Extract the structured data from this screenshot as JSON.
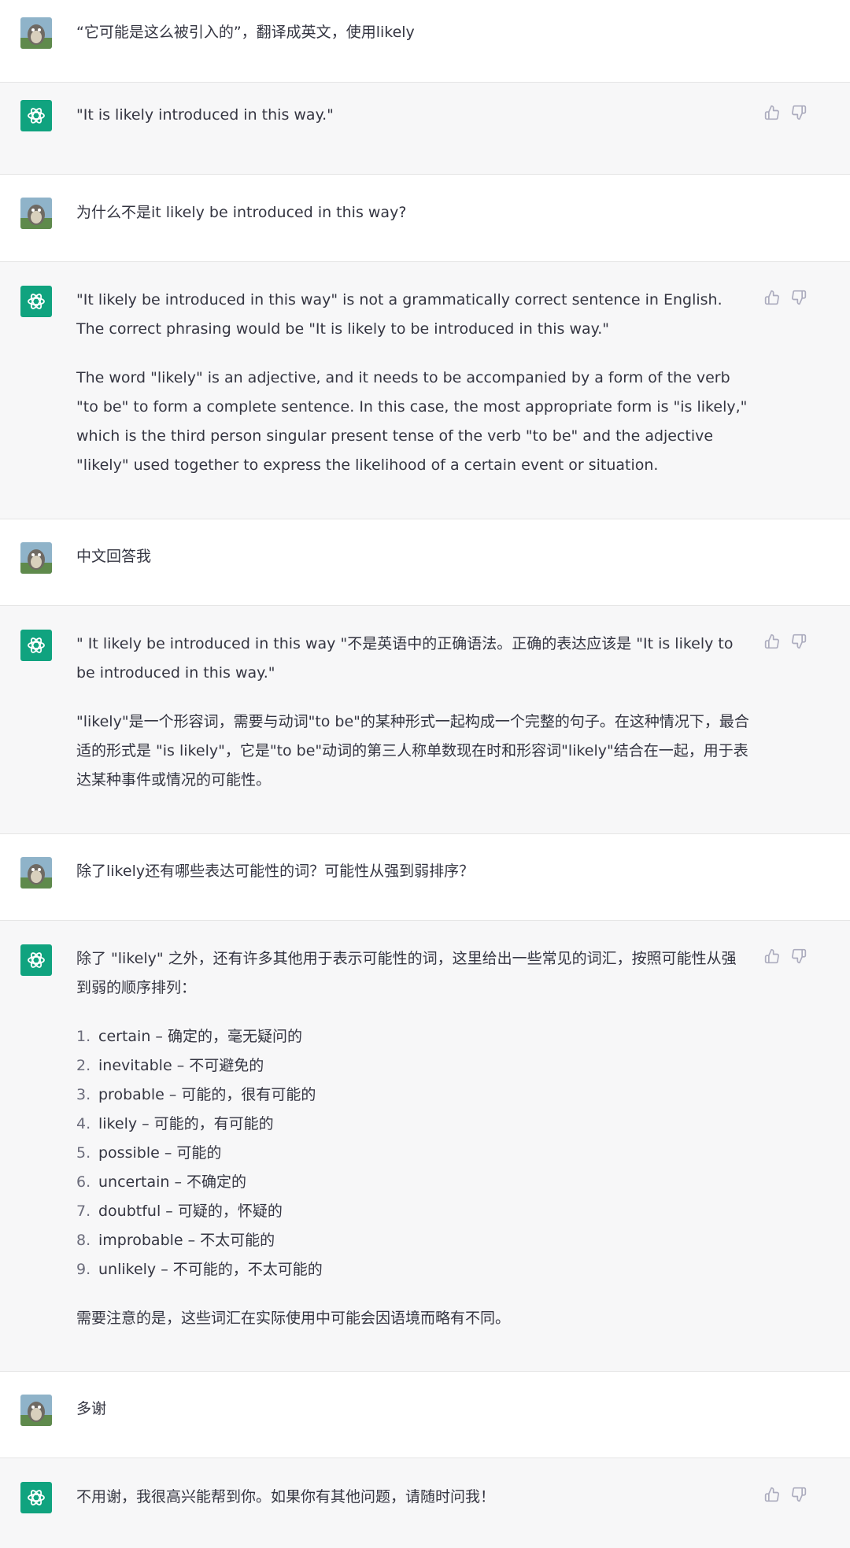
{
  "messages": [
    {
      "role": "user",
      "text": "“它可能是这么被引入的”，翻译成英文，使用likely"
    },
    {
      "role": "assistant",
      "paragraphs": [
        "\"It is likely introduced in this way.\""
      ]
    },
    {
      "role": "user",
      "text": "为什么不是it likely be introduced in this way?"
    },
    {
      "role": "assistant",
      "paragraphs": [
        "\"It likely be introduced in this way\" is not a grammatically correct sentence in English. The correct phrasing would be \"It is likely to be introduced in this way.\"",
        "The word \"likely\" is an adjective, and it needs to be accompanied by a form of the verb \"to be\" to form a complete sentence. In this case, the most appropriate form is \"is likely,\" which is the third person singular present tense of the verb \"to be\" and the adjective \"likely\" used together to express the likelihood of a certain event or situation."
      ]
    },
    {
      "role": "user",
      "text": "中文回答我"
    },
    {
      "role": "assistant",
      "paragraphs": [
        "\" It likely be introduced in this way \"不是英语中的正确语法。正确的表达应该是 \"It is likely to be introduced in this way.\"",
        "\"likely\"是一个形容词，需要与动词\"to be\"的某种形式一起构成一个完整的句子。在这种情况下，最合适的形式是 \"is likely\"，它是\"to be\"动词的第三人称单数现在时和形容词\"likely\"结合在一起，用于表达某种事件或情况的可能性。"
      ]
    },
    {
      "role": "user",
      "text": "除了likely还有哪些表达可能性的词？可能性从强到弱排序？"
    },
    {
      "role": "assistant",
      "intro": "除了 \"likely\" 之外，还有许多其他用于表示可能性的词，这里给出一些常见的词汇，按照可能性从强到弱的顺序排列：",
      "list": [
        {
          "num": "1.",
          "text": "certain – 确定的，毫无疑问的"
        },
        {
          "num": "2.",
          "text": "inevitable – 不可避免的"
        },
        {
          "num": "3.",
          "text": "probable – 可能的，很有可能的"
        },
        {
          "num": "4.",
          "text": "likely – 可能的，有可能的"
        },
        {
          "num": "5.",
          "text": "possible – 可能的"
        },
        {
          "num": "6.",
          "text": "uncertain – 不确定的"
        },
        {
          "num": "7.",
          "text": "doubtful – 可疑的，怀疑的"
        },
        {
          "num": "8.",
          "text": "improbable – 不太可能的"
        },
        {
          "num": "9.",
          "text": "unlikely – 不可能的，不太可能的"
        }
      ],
      "outro": "需要注意的是，这些词汇在实际使用中可能会因语境而略有不同。"
    },
    {
      "role": "user",
      "text": "多谢"
    },
    {
      "role": "assistant",
      "paragraphs": [
        "不用谢，我很高兴能帮到你。如果你有其他问题，请随时问我！"
      ]
    }
  ],
  "colors": {
    "assistant_bg": "#f7f7f8",
    "user_bg": "#ffffff",
    "brand": "#10a37f",
    "text": "#343541",
    "icon": "#acacbe"
  },
  "icons": {
    "assistant_avatar": "openai-logo-icon",
    "user_avatar": "user-avatar-image",
    "like": "thumbs-up-icon",
    "dislike": "thumbs-down-icon"
  }
}
